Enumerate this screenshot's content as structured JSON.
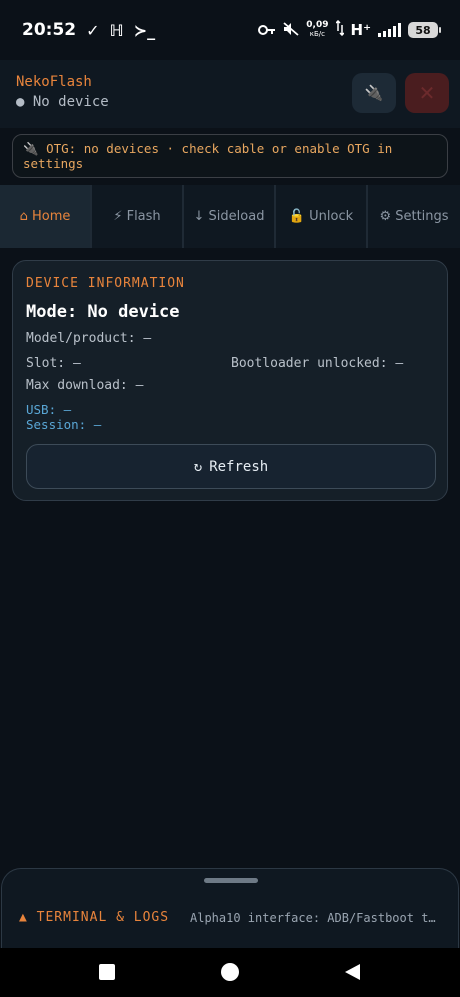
{
  "status_bar": {
    "time": "20:52",
    "left_icons": [
      "check-icon",
      "slash-icon",
      "terminal-icon"
    ],
    "net_speed_value": "0,09",
    "net_speed_unit": "кБ/с",
    "network_type": "H⁺",
    "battery": "58"
  },
  "header": {
    "app_title": "NekoFlash",
    "device_state": "● No device",
    "plug_icon": "🔌",
    "close_icon": "✕"
  },
  "otg_banner": {
    "text": "🔌 OTG: no devices · check cable or enable OTG in settings"
  },
  "tabs": [
    {
      "label": "⌂ Home",
      "active": true
    },
    {
      "label": "⚡ Flash",
      "active": false
    },
    {
      "label": "↓ Sideload",
      "active": false
    },
    {
      "label": "🔓 Unlock",
      "active": false
    },
    {
      "label": "⚙ Settings",
      "active": false
    }
  ],
  "device_card": {
    "title": "DEVICE INFORMATION",
    "mode": "Mode: No device",
    "model": "Model/product: —",
    "slot": "Slot: —",
    "bootloader": "Bootloader unlocked: —",
    "max_download": "Max download: —",
    "usb": "USB: —",
    "session": "Session: —",
    "refresh_icon": "↻",
    "refresh_label": "Refresh"
  },
  "terminal": {
    "title": "▲ TERMINAL & LOGS",
    "log_line": "Alpha10 interface: ADB/Fastboot t…"
  },
  "colors": {
    "accent": "#e8843c",
    "background": "#0b1118",
    "link": "#5aa7d6"
  }
}
